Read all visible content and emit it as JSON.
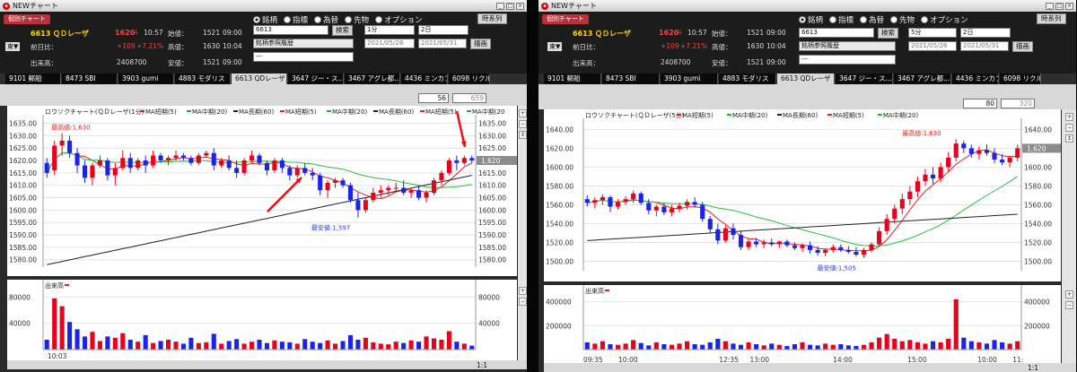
{
  "left": {
    "title": "NEWチャート",
    "kobetsu": "個別チャート",
    "radios": [
      "銘柄",
      "指標",
      "為替",
      "先物",
      "オプション"
    ],
    "series_btn": "時系列",
    "quote": {
      "name": "6613 ＱＤレーザ",
      "price": "1620",
      "arrow": "↓",
      "time": "10:57",
      "open_label": "始値：",
      "open": "1521",
      "open_time": "09:00",
      "chg_label": "前日比：",
      "chg": "+109",
      "chg_pct": "+7.21%",
      "high_label": "高値：",
      "high": "1630",
      "high_time": "10:04",
      "vol_label": "出来高：",
      "vol": "2408700",
      "low_label": "安値：",
      "low": "1521",
      "low_time": "09:00",
      "market": "東▼"
    },
    "code_input": "6613",
    "search_btn": "検索",
    "hist_select": "銘柄参照履歴",
    "blank_select": "---",
    "interval": "1分",
    "span": "2日",
    "date_from": "2021/05/28",
    "date_to": "2021/05/31",
    "draw_btn": "描画",
    "tabs": [
      "9101 郵船",
      "8473 SBI",
      "3903 gumi",
      "4883 モダリス",
      "6613 QDレーザ",
      "3647 ジー・ス...",
      "3467 アグレ都...",
      "4436 ミンカブ",
      "6098 リクルー..."
    ],
    "active_tab": 4,
    "pager_cur": "56",
    "pager_total": "659",
    "legend": "ロウソクチャート(ＱＤレーザ(1分)",
    "ma": [
      "MA短期(5)",
      "MA中期(20)",
      "MA長期(60)",
      "MA短期(5)",
      "MA中期(20)",
      "MA長期(60)",
      "MA短期(5)",
      "MA中期(20"
    ],
    "ma_colors": [
      "#e02020",
      "#20b020",
      "#222222",
      "#e02020",
      "#20b020",
      "#222222",
      "#e02020",
      "#20b020"
    ],
    "hi_label": "最高値:1,630",
    "lo_label": "最安値:1,597",
    "price_badge": "1,620",
    "price_ticks": [
      "1635.00",
      "1630.00",
      "1625.00",
      "1620.00",
      "1615.00",
      "1610.00",
      "1605.00",
      "1600.00",
      "1595.00",
      "1590.00",
      "1585.00",
      "1580.00"
    ],
    "vol_label_title": "出来高",
    "vol_ticks": [
      "80000",
      "40000"
    ],
    "time_label": "10:03",
    "zoom": "1:1"
  },
  "right": {
    "title": "NEWチャート",
    "kobetsu": "個別チャート",
    "radios": [
      "銘柄",
      "指標",
      "為替",
      "先物",
      "オプション"
    ],
    "series_btn": "時系列",
    "quote": {
      "name": "6613 ＱＤレーザ",
      "price": "1620",
      "arrow": "↓",
      "time": "10:57",
      "open_label": "始値：",
      "open": "1521",
      "open_time": "09:00",
      "chg_label": "前日比：",
      "chg": "+109",
      "chg_pct": "+7.21%",
      "high_label": "高値：",
      "high": "1630",
      "high_time": "10:04",
      "vol_label": "出来高：",
      "vol": "2408700",
      "low_label": "安値：",
      "low": "1521",
      "low_time": "09:00",
      "market": "東▼"
    },
    "code_input": "6613",
    "search_btn": "検索",
    "hist_select": "銘柄参照履歴",
    "blank_select": "---",
    "interval": "5分",
    "span": "2日",
    "date_from": "2021/05/28",
    "date_to": "2021/05/31",
    "draw_btn": "描画",
    "tabs": [
      "9101 郵船",
      "8473 SBI",
      "3903 gumi",
      "4883 モダリス",
      "6613 QDレーザ",
      "3647 ジー・ス...",
      "3467 アグレ都...",
      "4436 ミンカブ",
      "6098 リクルー..."
    ],
    "active_tab": 4,
    "pager_cur": "80",
    "pager_total": "320",
    "legend": "ロウソクチャート(ＱＤレーザ(5分)",
    "ma": [
      "MA短期(5)",
      "MA中期(20)",
      "MA長期(60)",
      "MA短期(5)",
      "MA中期(20)"
    ],
    "ma_colors": [
      "#e02020",
      "#20b020",
      "#222222",
      "#e02020",
      "#20b020"
    ],
    "hi_label": "最高値:1,630",
    "lo_label": "最安値:1,505",
    "price_badge": "1,620",
    "price_ticks": [
      "1640.00",
      "1620.00",
      "1600.00",
      "1580.00",
      "1560.00",
      "1540.00",
      "1520.00",
      "1500.00"
    ],
    "vol_label_title": "出来高",
    "vol_ticks": [
      "400000",
      "200000"
    ],
    "time_labels": [
      "09:35",
      "10:00",
      "12:35",
      "13:00",
      "14:00",
      "15:00",
      "10:00",
      "11:"
    ],
    "zoom": "1:1"
  },
  "chart_data": [
    {
      "type": "candlestick",
      "title": "ロウソクチャート(ＱＤレーザ(1分)",
      "interval": "1分",
      "ylim": [
        1577,
        1637
      ],
      "y_ticks": [
        1635,
        1630,
        1625,
        1620,
        1615,
        1610,
        1605,
        1600,
        1595,
        1590,
        1585,
        1580
      ],
      "series": [
        {
          "name": "6613 ＱＤレーザ",
          "ohlc": [
            [
              1619,
              1621,
              1613,
              1615
            ],
            [
              1616,
              1628,
              1614,
              1626
            ],
            [
              1626,
              1631,
              1622,
              1628
            ],
            [
              1628,
              1630,
              1621,
              1623
            ],
            [
              1623,
              1625,
              1615,
              1618
            ],
            [
              1618,
              1620,
              1611,
              1613
            ],
            [
              1613,
              1619,
              1610,
              1618
            ],
            [
              1618,
              1622,
              1617,
              1620
            ],
            [
              1620,
              1621,
              1612,
              1614
            ],
            [
              1614,
              1619,
              1610,
              1617
            ],
            [
              1617,
              1624,
              1616,
              1621
            ],
            [
              1621,
              1623,
              1615,
              1617
            ],
            [
              1617,
              1621,
              1616,
              1620
            ],
            [
              1620,
              1622,
              1615,
              1618
            ],
            [
              1618,
              1624,
              1617,
              1622
            ],
            [
              1622,
              1623,
              1619,
              1620
            ],
            [
              1620,
              1622,
              1618,
              1621
            ],
            [
              1621,
              1624,
              1620,
              1622
            ],
            [
              1622,
              1623,
              1620,
              1621
            ],
            [
              1621,
              1622,
              1618,
              1619
            ],
            [
              1619,
              1623,
              1618,
              1622
            ],
            [
              1622,
              1624,
              1621,
              1623
            ],
            [
              1623,
              1625,
              1616,
              1618
            ],
            [
              1618,
              1621,
              1617,
              1620
            ],
            [
              1620,
              1622,
              1616,
              1617
            ],
            [
              1617,
              1620,
              1613,
              1615
            ],
            [
              1615,
              1621,
              1614,
              1620
            ],
            [
              1620,
              1624,
              1619,
              1622
            ],
            [
              1622,
              1623,
              1618,
              1619
            ],
            [
              1619,
              1620,
              1614,
              1616
            ],
            [
              1616,
              1621,
              1615,
              1620
            ],
            [
              1620,
              1621,
              1615,
              1617
            ],
            [
              1617,
              1618,
              1612,
              1614
            ],
            [
              1614,
              1618,
              1613,
              1617
            ],
            [
              1617,
              1619,
              1614,
              1615
            ],
            [
              1615,
              1617,
              1612,
              1614
            ],
            [
              1614,
              1615,
              1606,
              1608
            ],
            [
              1608,
              1612,
              1605,
              1611
            ],
            [
              1611,
              1613,
              1609,
              1612
            ],
            [
              1612,
              1613,
              1609,
              1610
            ],
            [
              1610,
              1611,
              1603,
              1604
            ],
            [
              1604,
              1607,
              1597,
              1600
            ],
            [
              1600,
              1605,
              1599,
              1604
            ],
            [
              1604,
              1609,
              1603,
              1607
            ],
            [
              1607,
              1610,
              1605,
              1608
            ],
            [
              1608,
              1610,
              1606,
              1609
            ],
            [
              1609,
              1611,
              1607,
              1609
            ],
            [
              1609,
              1612,
              1606,
              1607
            ],
            [
              1607,
              1609,
              1605,
              1608
            ],
            [
              1608,
              1610,
              1604,
              1605
            ],
            [
              1605,
              1608,
              1603,
              1607
            ],
            [
              1607,
              1613,
              1606,
              1612
            ],
            [
              1612,
              1616,
              1610,
              1615
            ],
            [
              1615,
              1621,
              1614,
              1620
            ],
            [
              1620,
              1622,
              1616,
              1619
            ],
            [
              1619,
              1622,
              1618,
              1621
            ],
            [
              1621,
              1622,
              1619,
              1620
            ]
          ]
        }
      ],
      "volume": [
        15000,
        78000,
        66000,
        42000,
        31000,
        20000,
        27000,
        13000,
        20000,
        18000,
        25000,
        15000,
        12000,
        22000,
        10000,
        13000,
        15000,
        12000,
        9000,
        18000,
        10000,
        11000,
        24000,
        9000,
        13000,
        16000,
        9000,
        12000,
        15000,
        10000,
        14000,
        12000,
        11000,
        9000,
        16000,
        12000,
        10000,
        14000,
        9000,
        13000,
        22000,
        15000,
        18000,
        11000,
        9000,
        8000,
        12000,
        10000,
        14000,
        12000,
        20000,
        17000,
        15000,
        28000,
        12000,
        9000,
        6000
      ],
      "volume_ylim": [
        0,
        90000
      ],
      "high_label": "最高値:1,630",
      "low_label": "最安値:1,597",
      "last": 1620
    },
    {
      "type": "candlestick",
      "title": "ロウソクチャート(ＱＤレーザ(5分)",
      "interval": "5分",
      "ylim": [
        1490,
        1648
      ],
      "y_ticks": [
        1640,
        1620,
        1600,
        1580,
        1560,
        1540,
        1520,
        1500
      ],
      "series": [
        {
          "name": "6613 ＱＤレーザ",
          "ohlc": [
            [
              1566,
              1570,
              1558,
              1562
            ],
            [
              1562,
              1568,
              1556,
              1565
            ],
            [
              1565,
              1571,
              1560,
              1568
            ],
            [
              1568,
              1570,
              1552,
              1558
            ],
            [
              1558,
              1566,
              1555,
              1563
            ],
            [
              1563,
              1569,
              1560,
              1566
            ],
            [
              1566,
              1575,
              1562,
              1572
            ],
            [
              1572,
              1574,
              1560,
              1562
            ],
            [
              1562,
              1566,
              1550,
              1554
            ],
            [
              1554,
              1560,
              1548,
              1558
            ],
            [
              1558,
              1562,
              1549,
              1552
            ],
            [
              1552,
              1560,
              1548,
              1556
            ],
            [
              1556,
              1562,
              1552,
              1559
            ],
            [
              1559,
              1566,
              1555,
              1563
            ],
            [
              1563,
              1568,
              1557,
              1560
            ],
            [
              1560,
              1563,
              1542,
              1545
            ],
            [
              1545,
              1548,
              1530,
              1534
            ],
            [
              1534,
              1540,
              1518,
              1522
            ],
            [
              1522,
              1538,
              1520,
              1535
            ],
            [
              1535,
              1540,
              1523,
              1528
            ],
            [
              1528,
              1532,
              1512,
              1515
            ],
            [
              1515,
              1524,
              1512,
              1521
            ],
            [
              1521,
              1525,
              1515,
              1518
            ],
            [
              1518,
              1523,
              1514,
              1520
            ],
            [
              1520,
              1524,
              1516,
              1518
            ],
            [
              1518,
              1522,
              1514,
              1521
            ],
            [
              1521,
              1523,
              1515,
              1517
            ],
            [
              1517,
              1520,
              1512,
              1514
            ],
            [
              1514,
              1519,
              1510,
              1517
            ],
            [
              1517,
              1521,
              1508,
              1512
            ],
            [
              1512,
              1516,
              1506,
              1509
            ],
            [
              1509,
              1514,
              1505,
              1512
            ],
            [
              1512,
              1518,
              1509,
              1515
            ],
            [
              1515,
              1518,
              1510,
              1512
            ],
            [
              1512,
              1516,
              1508,
              1510
            ],
            [
              1510,
              1515,
              1505,
              1507
            ],
            [
              1507,
              1514,
              1504,
              1512
            ],
            [
              1512,
              1520,
              1510,
              1518
            ],
            [
              1518,
              1536,
              1516,
              1532
            ],
            [
              1532,
              1550,
              1528,
              1545
            ],
            [
              1545,
              1560,
              1540,
              1556
            ],
            [
              1556,
              1572,
              1550,
              1566
            ],
            [
              1566,
              1580,
              1560,
              1574
            ],
            [
              1574,
              1590,
              1568,
              1585
            ],
            [
              1585,
              1598,
              1580,
              1592
            ],
            [
              1592,
              1600,
              1582,
              1588
            ],
            [
              1588,
              1605,
              1584,
              1600
            ],
            [
              1600,
              1616,
              1595,
              1610
            ],
            [
              1610,
              1630,
              1606,
              1625
            ],
            [
              1625,
              1628,
              1615,
              1620
            ],
            [
              1620,
              1624,
              1610,
              1614
            ],
            [
              1614,
              1622,
              1608,
              1618
            ],
            [
              1618,
              1624,
              1612,
              1615
            ],
            [
              1615,
              1620,
              1604,
              1608
            ],
            [
              1608,
              1614,
              1602,
              1605
            ],
            [
              1605,
              1612,
              1600,
              1610
            ],
            [
              1610,
              1624,
              1606,
              1620
            ]
          ]
        }
      ],
      "volume": [
        60000,
        50000,
        70000,
        45000,
        40000,
        50000,
        80000,
        55000,
        35000,
        60000,
        45000,
        40000,
        50000,
        70000,
        45000,
        40000,
        60000,
        90000,
        70000,
        50000,
        40000,
        60000,
        45000,
        35000,
        50000,
        40000,
        30000,
        45000,
        60000,
        40000,
        35000,
        50000,
        40000,
        45000,
        35000,
        30000,
        40000,
        60000,
        100000,
        130000,
        90000,
        70000,
        80000,
        60000,
        50000,
        70000,
        60000,
        90000,
        420000,
        100000,
        70000,
        60000,
        50000,
        80000,
        60000,
        50000,
        70000
      ],
      "volume_ylim": [
        0,
        450000
      ],
      "high_label": "最高値:1,630",
      "low_label": "最安値:1,505",
      "last": 1620
    }
  ],
  "colors": {
    "up": "#e8001c",
    "down": "#1a24e8",
    "ma_short": "#e02020",
    "ma_mid": "#22c03a",
    "ma_long": "#222222",
    "arrow": "#ee1010",
    "badge": "#8c8c8c"
  }
}
